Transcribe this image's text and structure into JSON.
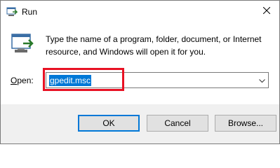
{
  "window": {
    "title": "Run",
    "close_glyph": "✕"
  },
  "description": "Type the name of a program, folder, document, or Internet resource, and Windows will open it for you.",
  "open": {
    "label_prefix": "",
    "label_accel": "O",
    "label_rest": "pen:",
    "value": "gpedit.msc"
  },
  "buttons": {
    "ok": "OK",
    "cancel": "Cancel",
    "browse": "Browse..."
  },
  "colors": {
    "accent": "#0078d7",
    "highlight": "#e81123",
    "footer": "#f0f0f0"
  },
  "icons": {
    "title": "run-icon",
    "body": "run-icon",
    "dropdown": "chevron-down-icon",
    "close": "close-icon"
  }
}
